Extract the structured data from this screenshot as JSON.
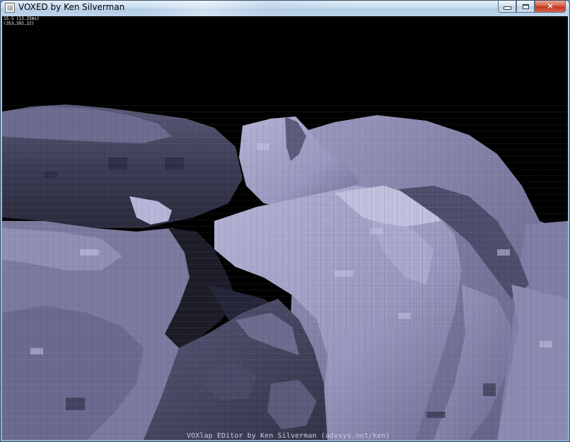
{
  "window": {
    "title": "VOXED by Ken Silverman",
    "minimize_label": "",
    "maximize_label": "",
    "close_label": "✕"
  },
  "hud": {
    "fps_line": "15.5 (13.25ms)",
    "position_line": "(353,392,22)"
  },
  "footer": {
    "credit": "VOXlap EDitor by Ken Silverman (advsys.net/ken)"
  },
  "colors": {
    "sky": "#000000",
    "terrain_light": "#a9a9cc",
    "terrain_mid": "#6f6f92",
    "terrain_dark": "#2c2c3e"
  }
}
